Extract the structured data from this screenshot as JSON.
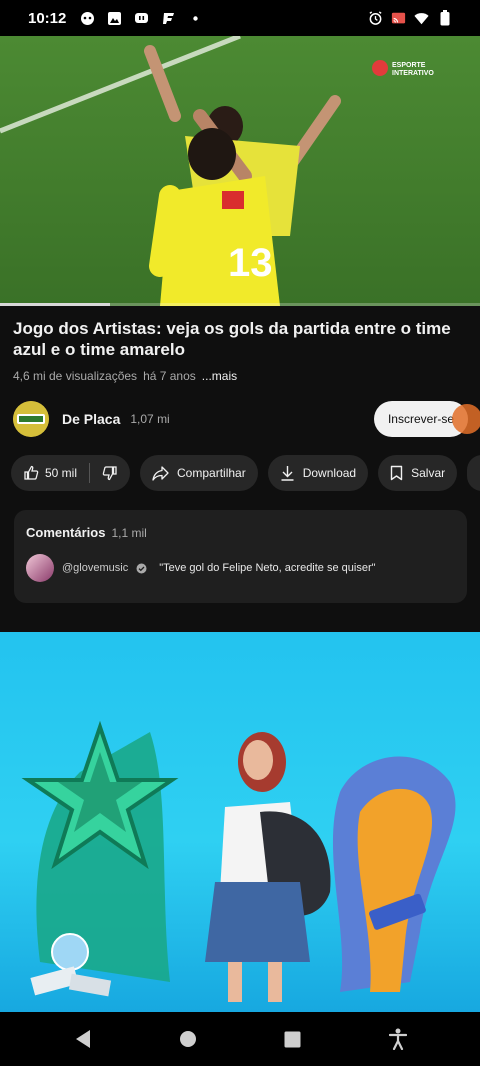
{
  "status_bar": {
    "time": "10:12",
    "left_icons": [
      "pokemon-icon",
      "gallery-icon",
      "twitch-icon",
      "app-f-icon",
      "dot-icon"
    ],
    "right_icons": [
      "alarm-icon",
      "cast-icon",
      "wifi-icon",
      "battery-icon"
    ]
  },
  "video": {
    "watermark": "ESPORTE INTERATIVO",
    "progress": 0.23
  },
  "title": "Jogo dos Artistas: veja os gols da partida entre o time azul e o time amarelo",
  "meta": {
    "views": "4,6 mi de visualizações",
    "age": "há 7 anos",
    "more": "...mais"
  },
  "channel": {
    "name": "De Placa",
    "subscribers": "1,07 mi",
    "subscribe_label": "Inscrever-se"
  },
  "actions": {
    "like_count": "50 mil",
    "share": "Compartilhar",
    "download": "Download",
    "save": "Salvar"
  },
  "comments": {
    "title": "Comentários",
    "count": "1,1 mil",
    "top_user": "@glovemusic",
    "top_text": "\"Teve gol do Felipe Neto, acredite se quiser\""
  },
  "colors": {
    "background": "#0f0f0f",
    "chip": "#272727",
    "accent": "#f1f1f1",
    "ad_background": "#2fd0f2"
  }
}
